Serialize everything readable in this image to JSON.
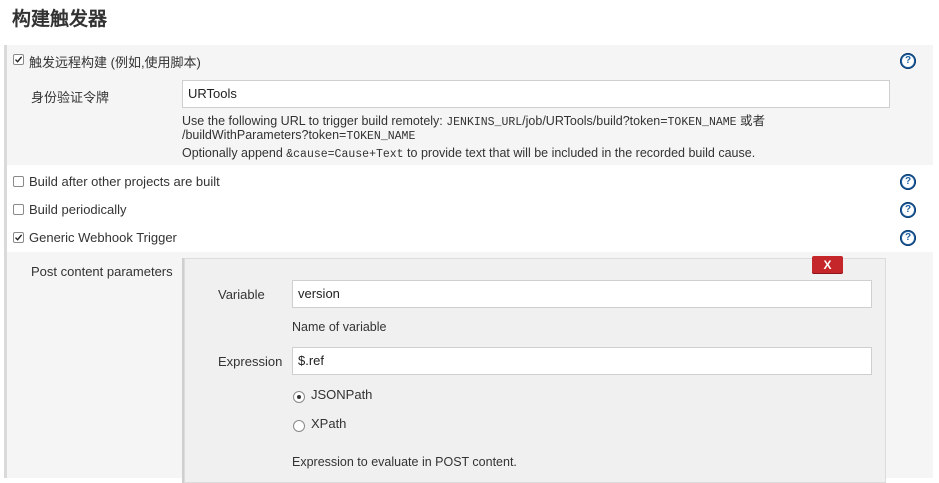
{
  "page_title": "构建触发器",
  "triggers": {
    "remote": {
      "checked": true,
      "label": "触发远程构建 (例如,使用脚本)",
      "token_label": "身份验证令牌",
      "token_value": "URTools",
      "hint_line1_a": "Use the following URL to trigger build remotely: ",
      "hint_line1_code": "JENKINS_URL",
      "hint_line1_b": "/job/URTools/build?token=",
      "hint_line1_code2": "TOKEN_NAME",
      "hint_line1_c": " 或者",
      "hint_line2_a": "/buildWithParameters?token=",
      "hint_line2_code": "TOKEN_NAME",
      "hint_line3_a": "Optionally append ",
      "hint_line3_code": "&cause=Cause+Text",
      "hint_line3_b": " to provide text that will be included in the recorded build cause."
    },
    "after_other": {
      "checked": false,
      "label": "Build after other projects are built"
    },
    "periodically": {
      "checked": false,
      "label": "Build periodically"
    },
    "webhook": {
      "checked": true,
      "label": "Generic Webhook Trigger",
      "post_params_label": "Post content parameters",
      "delete_label": "X",
      "variable_label": "Variable",
      "variable_value": "version",
      "variable_hint": "Name of variable",
      "expression_label": "Expression",
      "expression_value": "$.ref",
      "radio_options": [
        {
          "label": "JSONPath",
          "selected": true
        },
        {
          "label": "XPath",
          "selected": false
        }
      ],
      "expression_hint": "Expression to evaluate in POST content."
    }
  },
  "colors": {
    "help_icon": "#1f5f9f",
    "delete_button": "#c4262a",
    "section_background": "#f5f5f5"
  }
}
